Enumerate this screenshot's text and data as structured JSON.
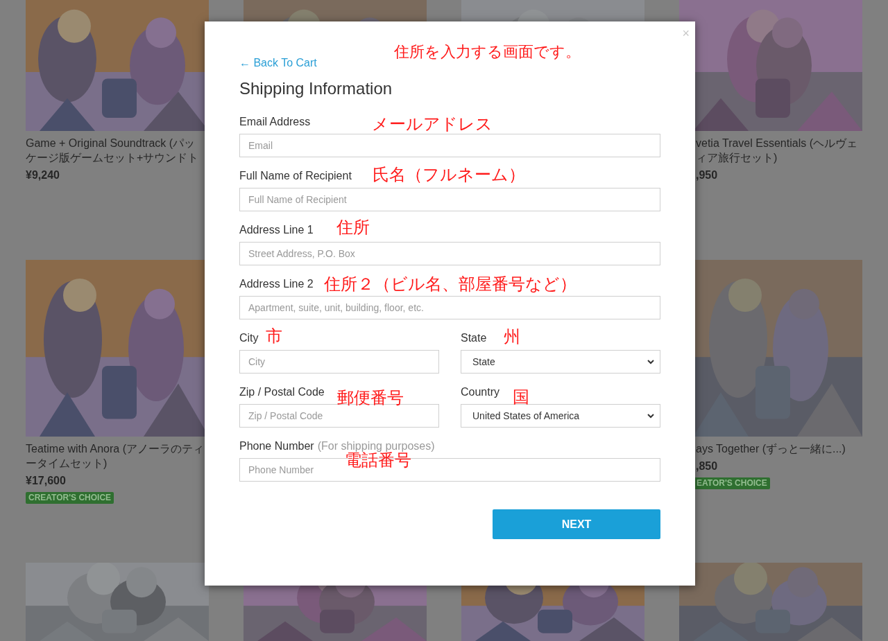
{
  "product_rows": [
    [
      {
        "kind": "picture",
        "title": "Game + Original Soundtrack (パッケージ版ゲームセット+サウンドト",
        "price": "¥9,240"
      },
      {
        "kind": "picture"
      },
      {
        "kind": "picture"
      },
      {
        "kind": "picture",
        "title": "vetia Travel Essentials (ヘルヴェィア旅行セット)",
        "price": ",950"
      }
    ],
    [
      {
        "kind": "picture",
        "title": "Teatime with Anora (アノーラのティータイムセット)",
        "price": "¥17,600",
        "badge": "CREATOR'S CHOICE"
      },
      {
        "kind": "picture",
        "title": "ays Together (ずっと一緒に...)",
        "price": ",850",
        "badge": "EATOR'S CHOICE"
      }
    ],
    [
      {
        "kind": "picture"
      },
      {
        "kind": "picture"
      },
      {
        "kind": "picture"
      },
      {
        "kind": "picture"
      }
    ]
  ],
  "modal": {
    "close": "×",
    "back_link": "← Back To Cart",
    "note": "住所を入力する画面です。",
    "title": "Shipping Information",
    "rows": [
      [
        {
          "kind": "text",
          "label": "Email Address",
          "placeholder": "Email",
          "note": "メールアドレス"
        }
      ],
      [
        {
          "kind": "text",
          "label": "Full Name of Recipient",
          "placeholder": "Full Name of Recipient",
          "note": "氏名（フルネーム）"
        }
      ],
      [
        {
          "kind": "text",
          "label": "Address Line 1",
          "placeholder": "Street Address, P.O. Box",
          "note": "住所"
        }
      ],
      [
        {
          "kind": "text",
          "label": "Address Line 2",
          "placeholder": "Apartment, suite, unit, building, floor, etc.",
          "note": "住所２（ビル名、部屋番号など）"
        }
      ],
      [
        {
          "kind": "text",
          "label": "City",
          "placeholder": "City",
          "note": "市"
        },
        {
          "kind": "select",
          "label": "State",
          "value": "State",
          "note": "州"
        }
      ],
      [
        {
          "kind": "text",
          "label": "Zip / Postal Code",
          "placeholder": "Zip / Postal Code",
          "note": "郵便番号"
        },
        {
          "kind": "select",
          "label": "Country",
          "value": "United States of America",
          "note": "国"
        }
      ],
      [
        {
          "kind": "text",
          "label": "Phone Number",
          "hint": "(For shipping purposes)",
          "placeholder": "Phone Number",
          "note": "電話番号"
        }
      ]
    ],
    "button": "NEXT"
  }
}
